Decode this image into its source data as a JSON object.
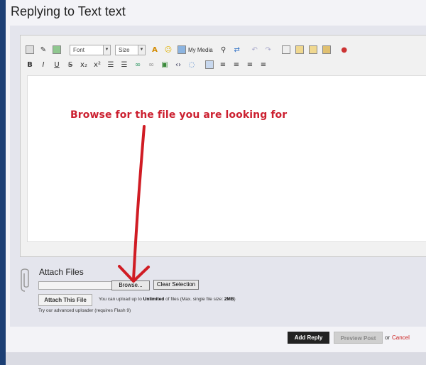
{
  "window": {
    "title": "Replying to Text text"
  },
  "toolbar": {
    "font_label": "Font",
    "size_label": "Size",
    "my_media_label": "My Media",
    "row2_text_icons": [
      "B",
      "I",
      "U",
      "S",
      "x₂",
      "x²"
    ]
  },
  "annotation": {
    "text": "Browse for the file you are looking for"
  },
  "attach": {
    "title": "Attach Files",
    "browse_label": "Browse...",
    "clear_label": "Clear Selection",
    "attach_button_label": "Attach This File",
    "upload_note_prefix": "You can upload up to ",
    "upload_note_bold": "Unlimited",
    "upload_note_suffix": " of files (Max. single file size: ",
    "upload_note_size": "2MB",
    "upload_note_end": ")",
    "advanced_note": "Try our advanced uploader (requires Flash 9)"
  },
  "footer": {
    "add_reply_label": "Add Reply",
    "preview_label": "Preview Post",
    "or_text": "or",
    "cancel_label": "Cancel"
  },
  "colors": {
    "annotation": "#cc2030",
    "window_bg": "#1c3f74",
    "panel": "#e4e5ed",
    "add_reply_bg": "#222222",
    "cancel_link": "#cc2222"
  }
}
